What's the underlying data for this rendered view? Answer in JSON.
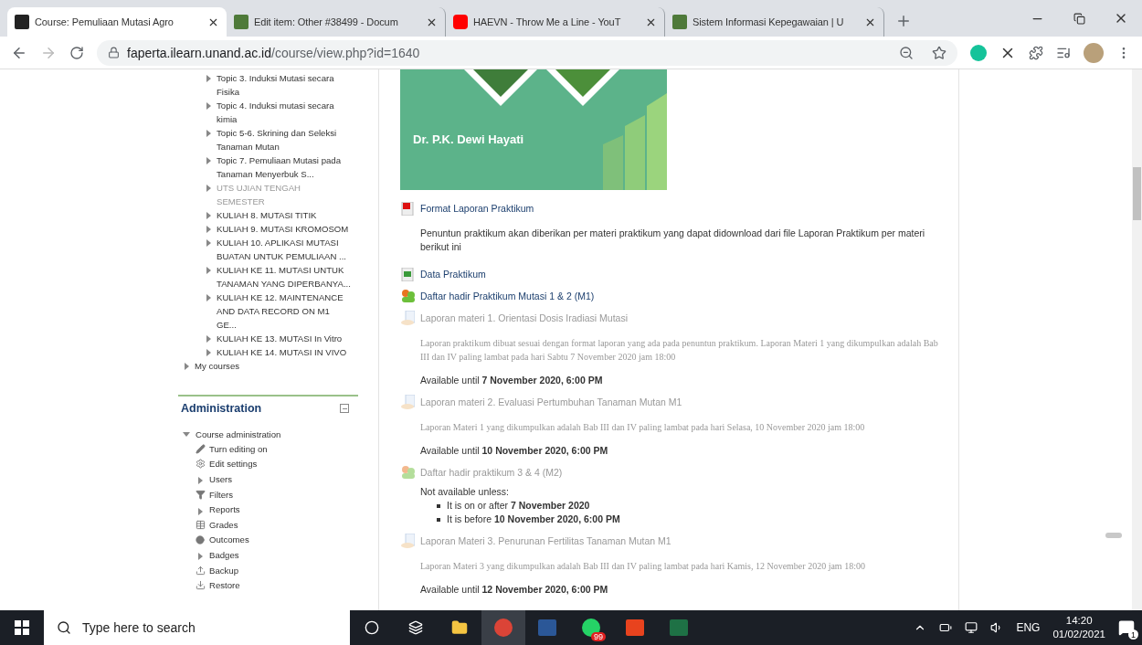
{
  "browser": {
    "tabs": [
      {
        "title": "Course: Pemuliaan Mutasi Agro",
        "kind": "moodle",
        "selected": true
      },
      {
        "title": "Edit item: Other #38499 - Docum",
        "kind": "site",
        "selected": false
      },
      {
        "title": "HAEVN - Throw Me a Line - YouT",
        "kind": "youtube",
        "selected": false
      },
      {
        "title": "Sistem Informasi Kepegawaian | U",
        "kind": "site",
        "selected": false
      }
    ],
    "url_host": "faperta.ilearn.unand.ac.id",
    "url_path": "/course/view.php?id=1640"
  },
  "sidebar": {
    "sections": [
      {
        "label": "Topic 3. Induksi Mutasi secara Fisika",
        "dimmed": false
      },
      {
        "label": "Topic 4. Induksi mutasi secara kimia",
        "dimmed": false
      },
      {
        "label": "Topic 5-6. Skrining dan Seleksi Tanaman Mutan",
        "dimmed": false
      },
      {
        "label": "Topic 7. Pemuliaan Mutasi pada Tanaman Menyerbuk S...",
        "dimmed": false
      },
      {
        "label": "UTS UJIAN TENGAH SEMESTER",
        "dimmed": true
      },
      {
        "label": "KULIAH 8. MUTASI TITIK",
        "dimmed": false
      },
      {
        "label": "KULIAH 9. MUTASI KROMOSOM",
        "dimmed": false
      },
      {
        "label": "KULIAH 10. APLIKASI MUTASI BUATAN UNTUK PEMULIAAN ...",
        "dimmed": false
      },
      {
        "label": "KULIAH KE 11. MUTASI UNTUK TANAMAN YANG DIPERBANYA...",
        "dimmed": false
      },
      {
        "label": "KULIAH KE 12. MAINTENANCE AND DATA RECORD ON M1 GE...",
        "dimmed": false
      },
      {
        "label": "KULIAH KE 13. MUTASI In Vitro",
        "dimmed": false
      },
      {
        "label": "KULIAH KE 14. MUTASI IN VIVO",
        "dimmed": false
      }
    ],
    "my_courses": {
      "label": "My courses",
      "expanded": false
    },
    "administration": {
      "title": "Administration",
      "node": {
        "label": "Course administration",
        "expanded": true,
        "children": [
          {
            "label": "Turn editing on",
            "kind": "pencil"
          },
          {
            "label": "Edit settings",
            "kind": "gear"
          },
          {
            "label": "Users",
            "kind": "branch"
          },
          {
            "label": "Filters",
            "kind": "filter"
          },
          {
            "label": "Reports",
            "kind": "branch"
          },
          {
            "label": "Grades",
            "kind": "table"
          },
          {
            "label": "Outcomes",
            "kind": "outcomes"
          },
          {
            "label": "Badges",
            "kind": "branch"
          },
          {
            "label": "Backup",
            "kind": "upload"
          },
          {
            "label": "Restore",
            "kind": "download"
          }
        ]
      }
    }
  },
  "banner": {
    "caption": "Dr. P.K. Dewi Hayati"
  },
  "activities": [
    {
      "kind": "pdf",
      "title": "Format Laporan Praktikum",
      "dimmed": false
    },
    {
      "kind": "label",
      "text": "Penuntun praktikum akan diberikan per materi praktikum yang dapat didownload dari file Laporan Praktikum per materi berikut ini"
    },
    {
      "kind": "spreadsheet",
      "title": "Data Praktikum",
      "dimmed": false
    },
    {
      "kind": "attendance",
      "title": "Daftar hadir Praktikum Mutasi 1 & 2 (M1)",
      "dimmed": false
    },
    {
      "kind": "assignment",
      "title": "Laporan materi 1. Orientasi Dosis Iradiasi Mutasi",
      "dimmed": true,
      "description": "Laporan praktikum dibuat sesuai dengan format laporan yang ada pada penuntun praktikum. Laporan Materi 1 yang dikumpulkan adalah Bab III dan IV paling lambat pada hari Sabtu 7 November 2020 jam 18:00",
      "availability": "Available until **7 November 2020, 6:00 PM**"
    },
    {
      "kind": "assignment",
      "title": "Laporan materi 2. Evaluasi Pertumbuhan Tanaman Mutan M1",
      "dimmed": true,
      "description": "Laporan Materi 1 yang dikumpulkan adalah Bab III dan IV paling lambat pada hari Selasa, 10 November 2020 jam 18:00",
      "availability": "Available until **10 November 2020, 6:00 PM**"
    },
    {
      "kind": "attendance",
      "title": "Daftar hadir praktikum 3 & 4 (M2)",
      "dimmed": true,
      "restriction": "Not available unless:",
      "conditions": [
        "It is on or after **7 November 2020**",
        "It is before **10 November 2020, 6:00 PM**"
      ]
    },
    {
      "kind": "assignment",
      "title": "Laporan Materi 3. Penurunan Fertilitas Tanaman Mutan M1",
      "dimmed": true,
      "description": "Laporan Materi 3 yang dikumpulkan adalah Bab III dan IV paling lambat pada hari Kamis, 12 November 2020 jam 18:00",
      "availability": "Available until **12 November 2020, 6:00 PM**"
    }
  ],
  "taskbar": {
    "search_placeholder": "Type here to search",
    "whatsapp_badge": "99",
    "language": "ENG",
    "time": "14:20",
    "date": "01/02/2021",
    "notifications": "1"
  }
}
